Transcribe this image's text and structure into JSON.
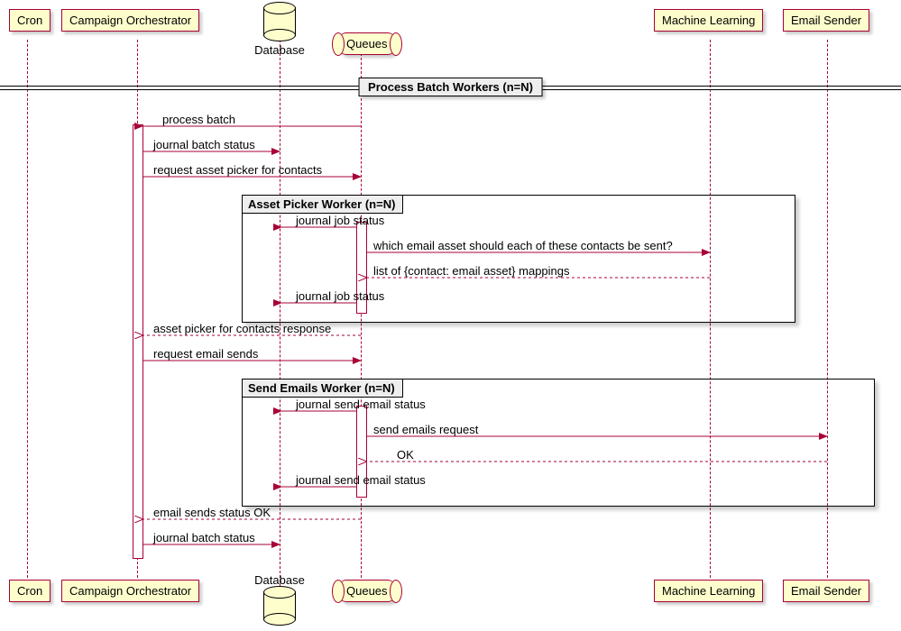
{
  "participants": {
    "cron": "Cron",
    "orchestrator": "Campaign Orchestrator",
    "database": "Database",
    "queues": "Queues",
    "ml": "Machine Learning",
    "sender": "Email Sender"
  },
  "divider": "Process Batch Workers (n=N)",
  "groups": {
    "asset_picker": "Asset Picker Worker (n=N)",
    "send_emails": "Send Emails Worker (n=N)"
  },
  "messages": {
    "m1": "process batch",
    "m2": "journal batch status",
    "m3": "request asset picker for contacts",
    "m4": "journal job status",
    "m5": "which email asset should each of these contacts be sent?",
    "m6": "list of {contact: email asset} mappings",
    "m7": "journal job status",
    "m8": "asset picker for contacts response",
    "m9": "request email sends",
    "m10": "journal send email status",
    "m11": "send emails request",
    "m12": "OK",
    "m13": "journal send email status",
    "m14": "email sends status OK",
    "m15": "journal batch status"
  }
}
